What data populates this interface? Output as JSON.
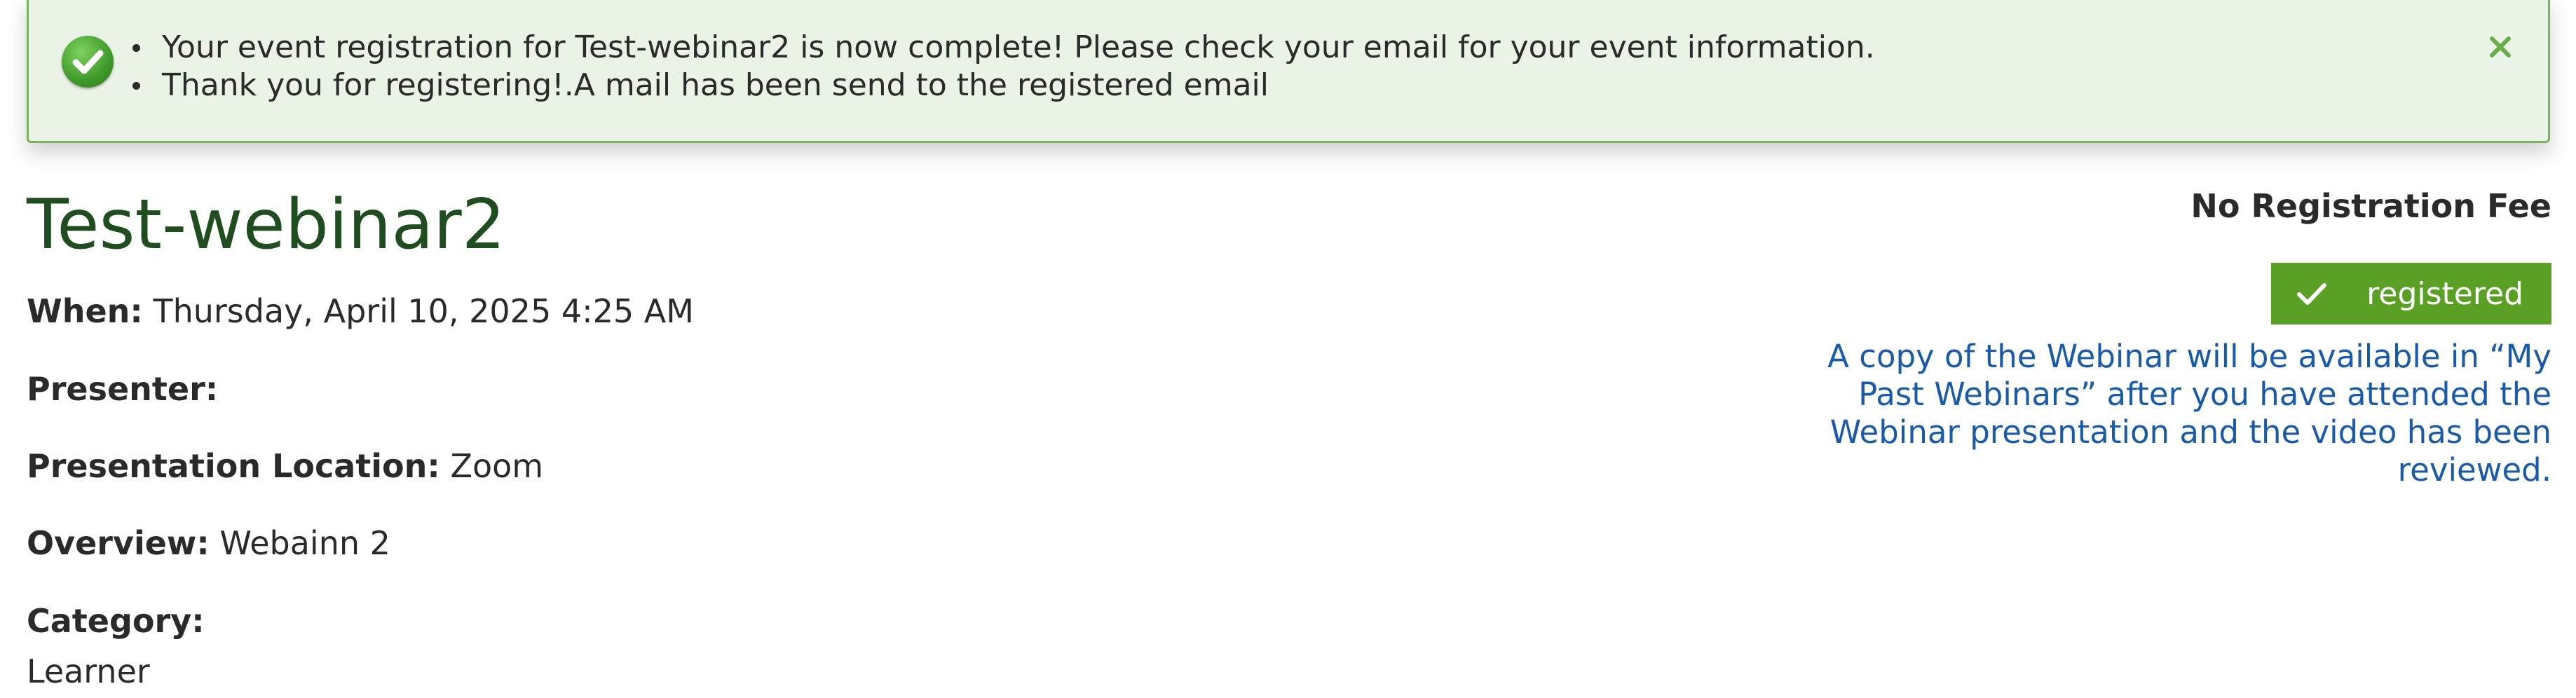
{
  "alert": {
    "messages": [
      "Your event registration for Test-webinar2 is now complete! Please check your email for your event information.",
      "Thank you for registering!.A mail has been send to the registered email"
    ],
    "icon": "check-circle-icon",
    "close_icon": "close-icon",
    "colors": {
      "background": "#eaf3e5",
      "border": "#7bb25f",
      "icon": "#3f9a2a"
    }
  },
  "event": {
    "title": "Test-webinar2",
    "when_label": "When:",
    "when_value": "Thursday, April 10, 2025 4:25 AM",
    "presenter_label": "Presenter:",
    "presenter_value": "",
    "location_label": "Presentation Location:",
    "location_value": "Zoom",
    "overview_label": "Overview:",
    "overview_value": "Webainn 2",
    "category_label": "Category:",
    "category_value": "Learner"
  },
  "sidebar": {
    "fee_text": "No Registration Fee",
    "registered_label": "registered",
    "registered_icon": "checkmark-icon",
    "note": "A copy of the Webinar will be available in “My Past Webinars” after you have attended the Webinar presentation and the video has been reviewed.",
    "colors": {
      "button": "#5aa025",
      "note_text": "#1a5aa8",
      "title": "#1f4d1f"
    }
  }
}
